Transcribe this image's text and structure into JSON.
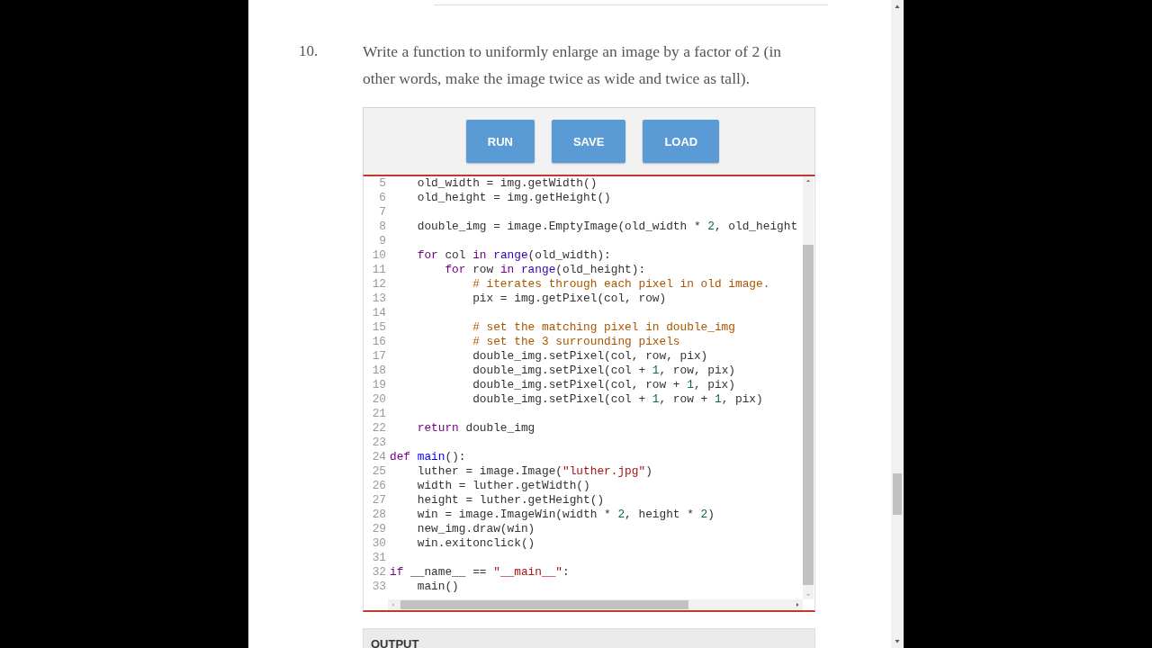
{
  "question": {
    "number": "10.",
    "text": "Write a function to uniformly enlarge an image by a factor of 2 (in other words, make the image twice as wide and twice as tall)."
  },
  "toolbar": {
    "buttons": [
      "RUN",
      "SAVE",
      "LOAD"
    ]
  },
  "editor": {
    "lines": [
      {
        "number": "5",
        "tokens": [
          {
            "kind": "plain",
            "text": "    old_width = img.getWidth()"
          }
        ]
      },
      {
        "number": "6",
        "tokens": [
          {
            "kind": "plain",
            "text": "    old_height = img.getHeight()"
          }
        ]
      },
      {
        "number": "7"
      },
      {
        "number": "8",
        "tokens": [
          {
            "kind": "plain",
            "text": "    double_img = image.EmptyImage(old_width * "
          },
          {
            "kind": "number",
            "text": "2"
          },
          {
            "kind": "plain",
            "text": ", old_height"
          }
        ]
      },
      {
        "number": "9"
      },
      {
        "number": "10",
        "tokens": [
          {
            "kind": "keyword",
            "text": "    for"
          },
          {
            "kind": "plain",
            "text": " col "
          },
          {
            "kind": "keyword",
            "text": "in"
          },
          {
            "kind": "builtin",
            "text": " range"
          },
          {
            "kind": "plain",
            "text": "(old_width):"
          }
        ]
      },
      {
        "number": "11",
        "tokens": [
          {
            "kind": "keyword",
            "text": "        for"
          },
          {
            "kind": "plain",
            "text": " row "
          },
          {
            "kind": "keyword",
            "text": "in"
          },
          {
            "kind": "builtin",
            "text": " range"
          },
          {
            "kind": "plain",
            "text": "(old_height):"
          }
        ]
      },
      {
        "number": "12",
        "tokens": [
          {
            "kind": "comment",
            "text": "            # iterates through each pixel in old image."
          }
        ]
      },
      {
        "number": "13",
        "tokens": [
          {
            "kind": "plain",
            "text": "            pix = img.getPixel(col, row)"
          }
        ]
      },
      {
        "number": "14"
      },
      {
        "number": "15",
        "tokens": [
          {
            "kind": "comment",
            "text": "            # set the matching pixel in double_img"
          }
        ]
      },
      {
        "number": "16",
        "tokens": [
          {
            "kind": "comment",
            "text": "            # set the 3 surrounding pixels"
          }
        ]
      },
      {
        "number": "17",
        "tokens": [
          {
            "kind": "plain",
            "text": "            double_img.setPixel(col, row, pix)"
          }
        ]
      },
      {
        "number": "18",
        "tokens": [
          {
            "kind": "plain",
            "text": "            double_img.setPixel(col + "
          },
          {
            "kind": "number",
            "text": "1"
          },
          {
            "kind": "plain",
            "text": ", row, pix)"
          }
        ]
      },
      {
        "number": "19",
        "tokens": [
          {
            "kind": "plain",
            "text": "            double_img.setPixel(col, row + "
          },
          {
            "kind": "number",
            "text": "1"
          },
          {
            "kind": "plain",
            "text": ", pix)"
          }
        ]
      },
      {
        "number": "20",
        "tokens": [
          {
            "kind": "plain",
            "text": "            double_img.setPixel(col + "
          },
          {
            "kind": "number",
            "text": "1"
          },
          {
            "kind": "plain",
            "text": ", row + "
          },
          {
            "kind": "number",
            "text": "1"
          },
          {
            "kind": "plain",
            "text": ", pix)"
          }
        ]
      },
      {
        "number": "21"
      },
      {
        "number": "22",
        "tokens": [
          {
            "kind": "keyword",
            "text": "    return"
          },
          {
            "kind": "plain",
            "text": " double_img"
          }
        ]
      },
      {
        "number": "23"
      },
      {
        "number": "24",
        "tokens": [
          {
            "kind": "keyword",
            "text": "def"
          },
          {
            "kind": "def",
            "text": " main"
          },
          {
            "kind": "plain",
            "text": "():"
          }
        ]
      },
      {
        "number": "25",
        "tokens": [
          {
            "kind": "plain",
            "text": "    luther = image.Image("
          },
          {
            "kind": "string",
            "text": "\"luther.jpg\""
          },
          {
            "kind": "plain",
            "text": ")"
          }
        ]
      },
      {
        "number": "26",
        "tokens": [
          {
            "kind": "plain",
            "text": "    width = luther.getWidth()"
          }
        ]
      },
      {
        "number": "27",
        "tokens": [
          {
            "kind": "plain",
            "text": "    height = luther.getHeight()"
          }
        ]
      },
      {
        "number": "28",
        "tokens": [
          {
            "kind": "plain",
            "text": "    win = image.ImageWin(width * "
          },
          {
            "kind": "number",
            "text": "2"
          },
          {
            "kind": "plain",
            "text": ", height * "
          },
          {
            "kind": "number",
            "text": "2"
          },
          {
            "kind": "plain",
            "text": ")"
          }
        ]
      },
      {
        "number": "29",
        "tokens": [
          {
            "kind": "plain",
            "text": "    new_img.draw(win)"
          }
        ]
      },
      {
        "number": "30",
        "tokens": [
          {
            "kind": "plain",
            "text": "    win.exitonclick()"
          }
        ]
      },
      {
        "number": "31"
      },
      {
        "number": "32",
        "tokens": [
          {
            "kind": "keyword",
            "text": "if"
          },
          {
            "kind": "plain",
            "text": " __name__ == "
          },
          {
            "kind": "string",
            "text": "\"__main__\""
          },
          {
            "kind": "plain",
            "text": ":"
          }
        ]
      },
      {
        "number": "33",
        "tokens": [
          {
            "kind": "plain",
            "text": "    main()"
          }
        ]
      }
    ]
  },
  "output": {
    "title": "OUTPUT"
  }
}
